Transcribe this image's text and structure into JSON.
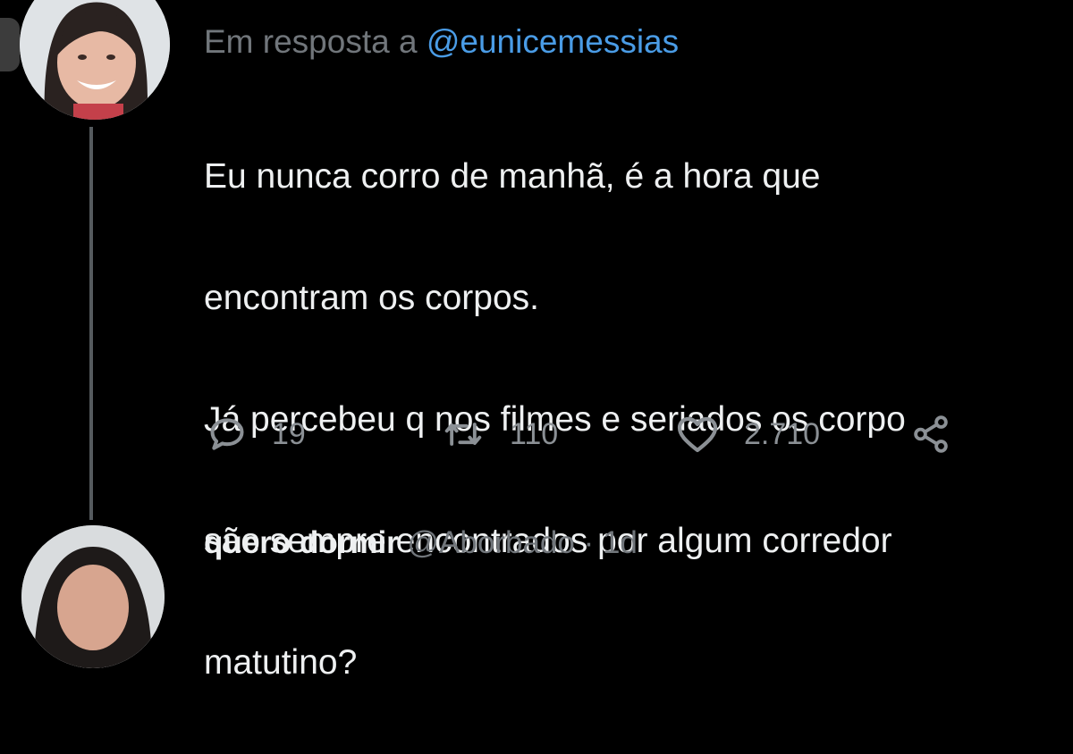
{
  "reply_context": {
    "prefix": "Em resposta a ",
    "mention": "@eunicemessias"
  },
  "tweet": {
    "lines": [
      "Eu nunca corro de manhã, é a hora que",
      "encontram os corpos.",
      "Já percebeu q nos filmes e seriados os corpo",
      "são sempre encontrados por algum corredor",
      "matutino?"
    ]
  },
  "actions": {
    "reply": {
      "icon": "reply-icon",
      "count": "19"
    },
    "retweet": {
      "icon": "retweet-icon",
      "count": "110"
    },
    "like": {
      "icon": "heart-icon",
      "count": "2.710"
    },
    "share": {
      "icon": "share-icon"
    }
  },
  "next_tweet": {
    "display_name": "quero dormir",
    "meta": "@Aborbado · 1d"
  },
  "colors": {
    "background": "#000000",
    "text": "#eef0f1",
    "muted": "#71767b",
    "mention": "#4a9ce6",
    "thread_line": "#555a5e"
  }
}
